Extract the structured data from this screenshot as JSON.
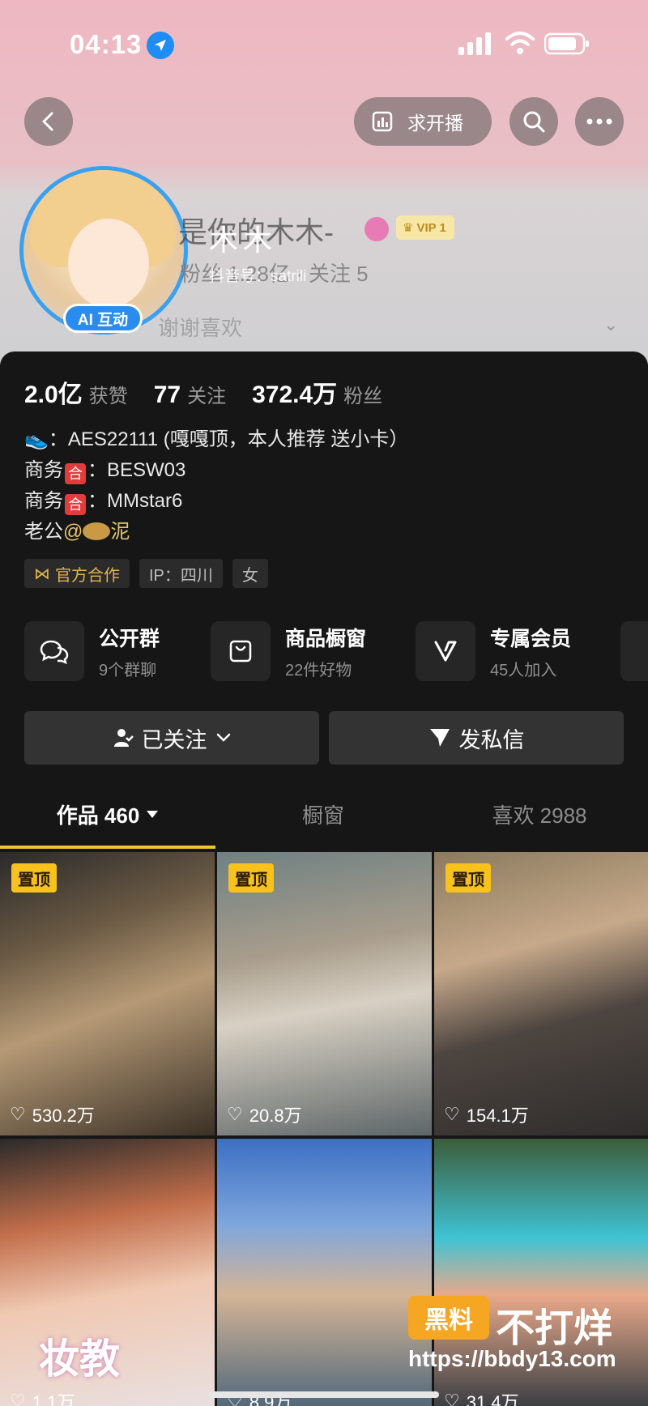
{
  "status": {
    "time": "04:13"
  },
  "header": {
    "live_label": "求开播"
  },
  "profile": {
    "ai_badge": "AI 互动",
    "name_faded": "是你的木木-",
    "name_overlay": "木木",
    "vip": "VIP 1",
    "sub_faded": "粉丝 1.28亿 · 关注 5",
    "douyin_id": "抖音号：satrili",
    "bio_faded": "谢谢喜欢"
  },
  "stats": [
    {
      "num": "2.0亿",
      "label": "获赞"
    },
    {
      "num": "77",
      "label": "关注"
    },
    {
      "num": "372.4万",
      "label": "粉丝"
    }
  ],
  "bio": {
    "line1": "：AES22111 (嘎嘎顶，本人推荐 送小卡）",
    "line2_prefix": "商务",
    "line2_badge": "合",
    "line2_value": "：BESW03",
    "line3_prefix": "商务",
    "line3_badge": "合",
    "line3_value": "：MMstar6",
    "line4_prefix": "老公",
    "line4_mention": "@",
    "line4_suffix": "泥"
  },
  "tags": [
    "官方合作",
    "IP：四川",
    "女"
  ],
  "features": [
    {
      "title": "公开群",
      "sub": "9个群聊"
    },
    {
      "title": "商品橱窗",
      "sub": "22件好物"
    },
    {
      "title": "专属会员",
      "sub": "45人加入"
    }
  ],
  "actions": {
    "follow": "已关注",
    "message": "发私信"
  },
  "tabs": {
    "works": "作品 460",
    "window": "橱窗",
    "likes": "喜欢 2988"
  },
  "pin_label": "置顶",
  "tiles": [
    {
      "likes": "530.2万",
      "pinned": true
    },
    {
      "likes": "20.8万",
      "pinned": true
    },
    {
      "likes": "154.1万",
      "pinned": true
    },
    {
      "likes": "1.1万",
      "pinned": false,
      "caption": "妆教"
    },
    {
      "likes": "8.9万",
      "pinned": false
    },
    {
      "likes": "31.4万",
      "pinned": false
    }
  ],
  "watermark": {
    "logo": "黑料",
    "text": "不打烊",
    "url": "https://bbdy13.com"
  }
}
